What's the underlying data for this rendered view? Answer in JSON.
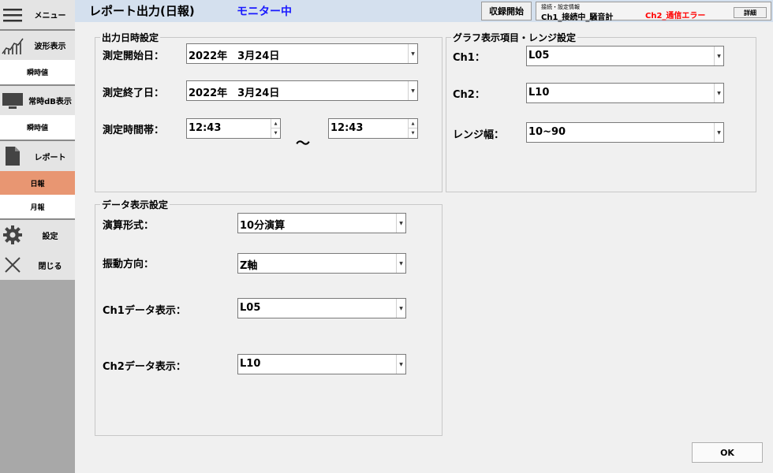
{
  "sidebar": {
    "menu_label": "メニュー",
    "waveform_label": "波形表示",
    "waveform_sub": "瞬時値",
    "db_label": "常時dB表示",
    "db_sub": "瞬時値",
    "report_label": "レポート",
    "report_daily": "日報",
    "report_monthly": "月報",
    "settings_label": "設定",
    "close_label": "閉じる"
  },
  "header": {
    "title": "レポート出力(日報)",
    "status": "モニター中",
    "record_button": "収録開始",
    "conn_title": "接続・設定情報",
    "conn_ch1": "Ch1_接続中_騒音計",
    "conn_ch2": "Ch2_通信エラー",
    "detail_button": "詳細"
  },
  "datetime": {
    "title": "出力日時設定",
    "start_label": "測定開始日：",
    "start_value": "2022年　3月24日",
    "end_label": "測定終了日：",
    "end_value": "2022年　3月24日",
    "time_label": "測定時間帯：",
    "time_from": "12:43",
    "time_sep": "～",
    "time_to": "12:43"
  },
  "graph": {
    "title": "グラフ表示項目・レンジ設定",
    "ch1_label": "Ch1：",
    "ch1_value": "L05",
    "ch2_label": "Ch2：",
    "ch2_value": "L10",
    "range_label": "レンジ幅：",
    "range_value": "10~90"
  },
  "display": {
    "title": "データ表示設定",
    "calc_label": "演算形式：",
    "calc_value": "10分演算",
    "axis_label": "振動方向：",
    "axis_value": "Z軸",
    "ch1_label": "Ch1データ表示：",
    "ch1_value": "L05",
    "ch2_label": "Ch2データ表示：",
    "ch2_value": "L10"
  },
  "ok_button": "OK"
}
